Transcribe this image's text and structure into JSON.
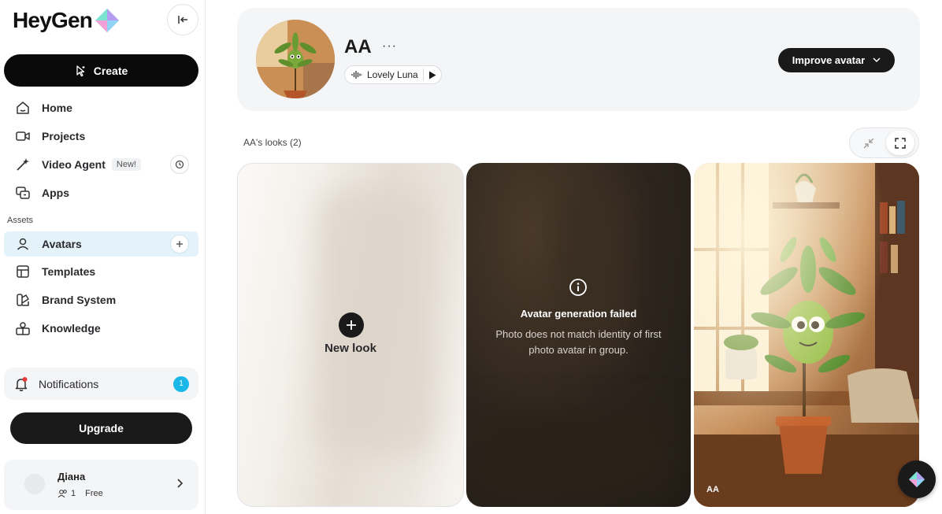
{
  "app": {
    "logo_text": "HeyGen"
  },
  "sidebar": {
    "create_label": "Create",
    "items": [
      {
        "label": "Home"
      },
      {
        "label": "Projects"
      },
      {
        "label": "Video Agent",
        "badge": "New!"
      },
      {
        "label": "Apps"
      }
    ],
    "section_assets": "Assets",
    "asset_items": [
      {
        "label": "Avatars"
      },
      {
        "label": "Templates"
      },
      {
        "label": "Brand System"
      },
      {
        "label": "Knowledge"
      }
    ],
    "notifications": {
      "label": "Notifications",
      "count": "1"
    },
    "upgrade_label": "Upgrade",
    "user": {
      "name": "Діана",
      "members": "1",
      "plan": "Free"
    }
  },
  "header": {
    "avatar_name": "AA",
    "more_label": "···",
    "voice_name": "Lovely Luna",
    "improve_label": "Improve avatar"
  },
  "looks": {
    "title": "AA's looks (2)",
    "new_look_label": "New look",
    "failed": {
      "title": "Avatar generation failed",
      "description": "Photo does not match identity of first photo avatar in group."
    },
    "photo_label": "AA"
  },
  "colors": {
    "accent": "#19b8e8",
    "active_nav_bg": "#e4f3fa",
    "dark": "#1a1a1a"
  }
}
